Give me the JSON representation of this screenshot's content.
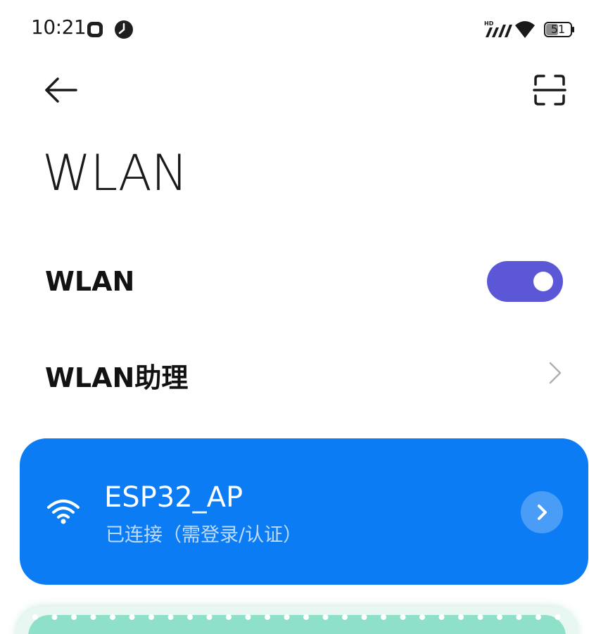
{
  "status_bar": {
    "time": "10:21",
    "battery_level": "51",
    "network_badge": "HD",
    "icons": [
      "app-notification-icon",
      "clock-icon",
      "hd-signal-icon",
      "wifi-status-icon",
      "battery-icon"
    ]
  },
  "header": {
    "back_icon": "back-arrow-icon",
    "scan_icon": "scan-icon",
    "title": "WLAN"
  },
  "settings": {
    "wlan_label": "WLAN",
    "wlan_enabled": true,
    "assistant_label": "WLAN助理"
  },
  "connected_network": {
    "ssid": "ESP32_AP",
    "status": "已连接（需登录/认证）",
    "icon": "wifi-icon",
    "detail_icon": "chevron-right-icon"
  },
  "colors": {
    "accent_toggle": "#5b57d6",
    "card_blue": "#0c7cf4",
    "bottom_card": "#8ee0c8"
  }
}
